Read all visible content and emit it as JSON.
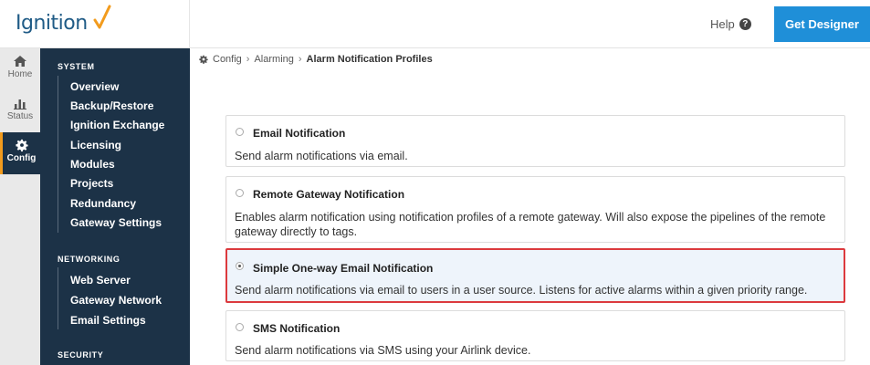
{
  "header": {
    "logo_text": "Ignition",
    "help_label": "Help",
    "get_designer_label": "Get Designer"
  },
  "rail": [
    {
      "label": "Home",
      "icon": "home-icon"
    },
    {
      "label": "Status",
      "icon": "bar-chart-icon"
    },
    {
      "label": "Config",
      "icon": "gear-icon",
      "active": true
    }
  ],
  "sidebar": {
    "system_heading": "SYSTEM",
    "system_items": [
      "Overview",
      "Backup/Restore",
      "Ignition Exchange",
      "Licensing",
      "Modules",
      "Projects",
      "Redundancy",
      "Gateway Settings"
    ],
    "networking_heading": "NETWORKING",
    "networking_items": [
      "Web Server",
      "Gateway Network",
      "Email Settings"
    ],
    "security_heading": "SECURITY"
  },
  "breadcrumb": {
    "items": [
      "Config",
      "Alarming"
    ],
    "current": "Alarm Notification Profiles"
  },
  "options": [
    {
      "title": "Email Notification",
      "description": "Send alarm notifications via email."
    },
    {
      "title": "Remote Gateway Notification",
      "description": "Enables alarm notification using notification profiles of a remote gateway. Will also expose the pipelines of the remote gateway directly to tags."
    },
    {
      "title": "Simple One-way Email Notification",
      "description": "Send alarm notifications via email to users in a user source. Listens for active alarms within a given priority range.",
      "selected": true
    },
    {
      "title": "SMS Notification",
      "description": "Send alarm notifications via SMS using your Airlink device."
    }
  ],
  "colors": {
    "sidebar": "#1c3247",
    "accent": "#1f8fd8",
    "logo_check": "#f29b1d",
    "highlight": "#dc3a3e"
  }
}
